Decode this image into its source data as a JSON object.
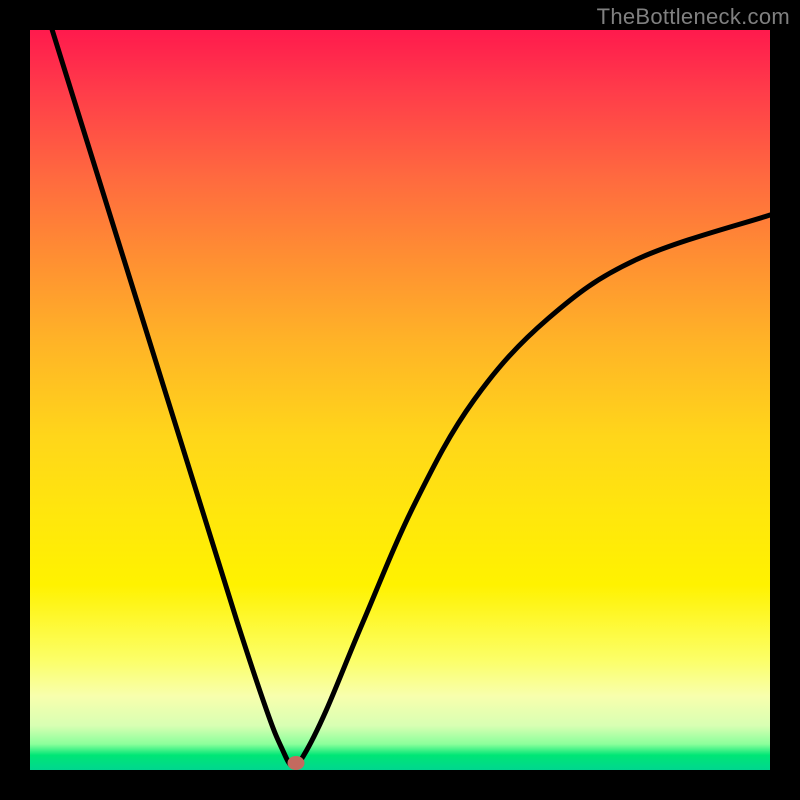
{
  "watermark": "TheBottleneck.com",
  "colors": {
    "frame": "#000000",
    "curve": "#000000",
    "marker": "#c36a5f",
    "gradient_top": "#ff1a4d",
    "gradient_mid": "#ffd61a",
    "gradient_bottom": "#00d68f"
  },
  "chart_data": {
    "type": "line",
    "title": "",
    "xlabel": "",
    "ylabel": "",
    "xlim": [
      0,
      100
    ],
    "ylim": [
      0,
      100
    ],
    "grid": false,
    "legend": false,
    "series": [
      {
        "name": "bottleneck-curve",
        "x": [
          3,
          8,
          13,
          18,
          23,
          28,
          32,
          34,
          35.5,
          37,
          40,
          45,
          52,
          60,
          70,
          82,
          100
        ],
        "y": [
          100,
          84,
          68,
          52,
          36,
          20,
          8,
          3,
          0.5,
          2,
          8,
          20,
          36,
          50,
          61,
          69,
          75
        ]
      }
    ],
    "annotations": [
      {
        "name": "optimal-point-marker",
        "x": 36,
        "y": 1
      }
    ]
  }
}
